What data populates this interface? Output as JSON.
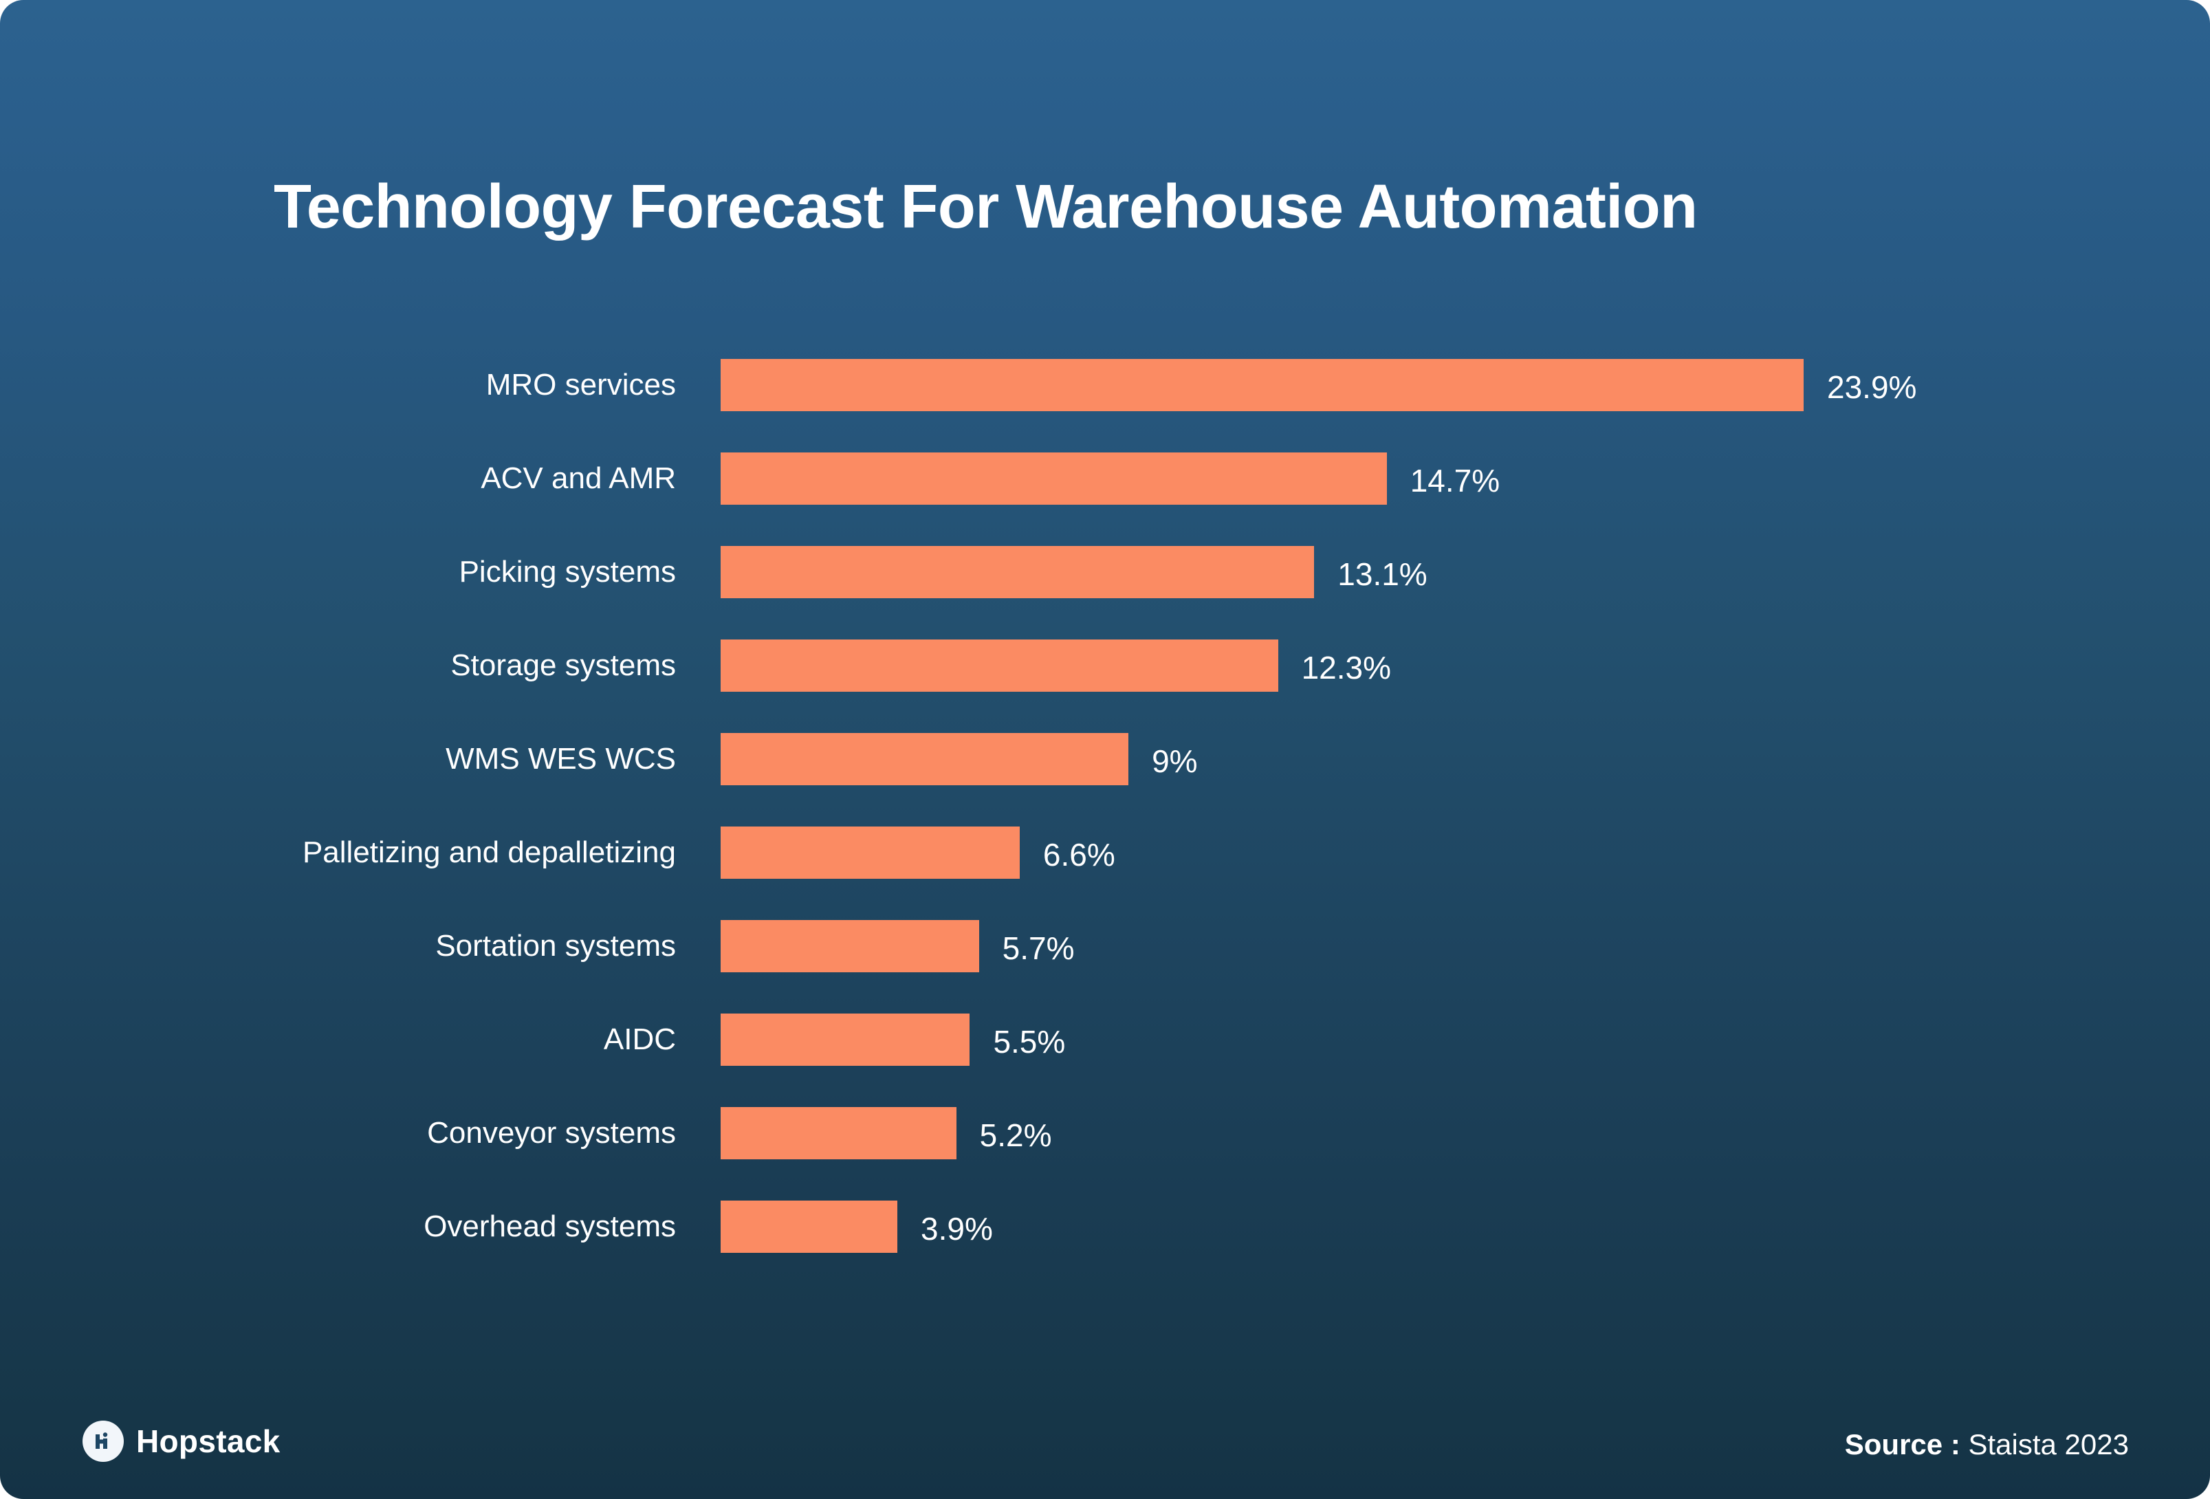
{
  "title": "Technology Forecast For Warehouse Automation",
  "colors": {
    "bar": "#fb8b63",
    "background_top": "#2c628f",
    "background_bottom": "#143245",
    "text": "#ffffff"
  },
  "footer": {
    "logo_name": "Hopstack",
    "logo_icon": "hopstack-hi-monogram-icon",
    "source_key": "Source :",
    "source_value": "Staista 2023"
  },
  "chart_data": {
    "type": "bar",
    "orientation": "horizontal",
    "title": "Technology Forecast For Warehouse Automation",
    "xlabel": "",
    "ylabel": "",
    "grid": false,
    "legend": null,
    "xlim": [
      0,
      23.9
    ],
    "value_suffix": "%",
    "categories": [
      "MRO services",
      "ACV and AMR",
      "Picking systems",
      "Storage systems",
      "WMS WES WCS",
      "Palletizing and depalletizing",
      "Sortation systems",
      "AIDC",
      "Conveyor systems",
      "Overhead systems"
    ],
    "values": [
      23.9,
      14.7,
      13.1,
      12.3,
      9,
      6.6,
      5.7,
      5.5,
      5.2,
      3.9
    ],
    "value_labels": [
      "23.9%",
      "14.7%",
      "13.1%",
      "12.3%",
      "9%",
      "6.6%",
      "5.7%",
      "5.5%",
      "5.2%",
      "3.9%"
    ]
  }
}
